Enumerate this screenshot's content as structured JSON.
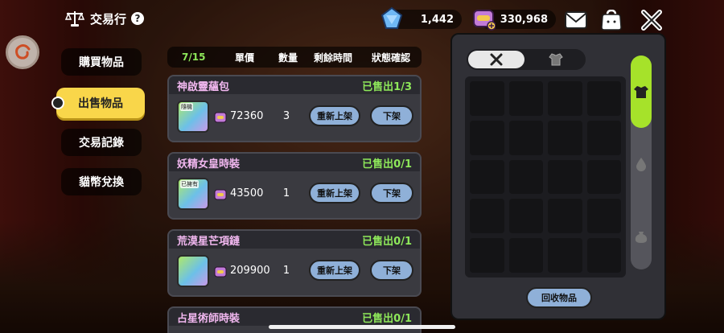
{
  "header": {
    "title": "交易行",
    "help": "?"
  },
  "currency": {
    "gems": "1,442",
    "coins": "330,968"
  },
  "menu": [
    {
      "label": "購買物品",
      "active": false
    },
    {
      "label": "出售物品",
      "active": true
    },
    {
      "label": "交易記錄",
      "active": false
    },
    {
      "label": "貓幣兌換",
      "active": false
    }
  ],
  "list_header": {
    "count": "7/15",
    "price": "單價",
    "qty": "數量",
    "time": "剩餘時間",
    "status": "狀態確認"
  },
  "listings": [
    {
      "name": "神啟靈蘊包",
      "sold": "已售出1/3",
      "tag": "隨機",
      "price": "72360",
      "qty": "3",
      "relist": "重新上架",
      "remove": "下架"
    },
    {
      "name": "妖精女皇時裝",
      "sold": "已售出0/1",
      "tag": "已擁有",
      "price": "43500",
      "qty": "1",
      "relist": "重新上架",
      "remove": "下架"
    },
    {
      "name": "荒漠星芒項鏈",
      "sold": "已售出0/1",
      "tag": "",
      "price": "209900",
      "qty": "1",
      "relist": "重新上架",
      "remove": "下架"
    },
    {
      "name": "占星術師時裝",
      "sold": "已售出0/1"
    }
  ],
  "inventory": {
    "recycle_label": "回收物品"
  },
  "colors": {
    "accent": "#f9d64a",
    "sold": "#8ee85a",
    "item_name": "#f2b8f0",
    "button": "#8fb0d8",
    "tab_active": "#a6e22a"
  }
}
